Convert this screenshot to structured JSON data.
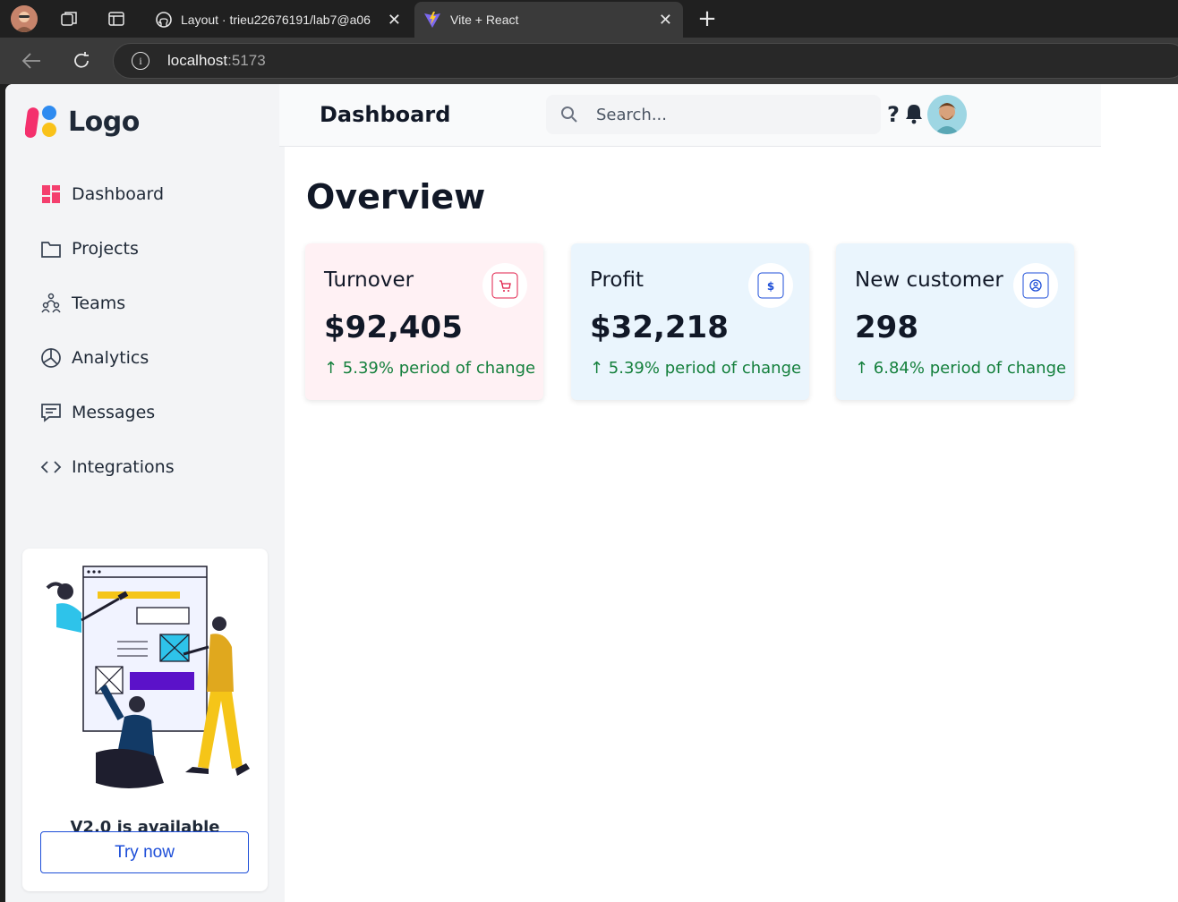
{
  "browser": {
    "tabs": [
      {
        "title": "Layout · trieu22676191/lab7@a06",
        "icon": "github-icon"
      },
      {
        "title": "Vite + React",
        "icon": "vite-icon"
      }
    ],
    "url": {
      "host": "localhost",
      "port": ":5173"
    }
  },
  "app": {
    "logo_text": "Logo",
    "header": {
      "title": "Dashboard",
      "search_placeholder": "Search...",
      "help_label": "?"
    },
    "sidebar": {
      "items": [
        {
          "label": "Dashboard",
          "icon": "dashboard-icon",
          "active": true
        },
        {
          "label": "Projects",
          "icon": "folder-icon"
        },
        {
          "label": "Teams",
          "icon": "teams-icon"
        },
        {
          "label": "Analytics",
          "icon": "pie-chart-icon"
        },
        {
          "label": "Messages",
          "icon": "message-icon"
        },
        {
          "label": "Integrations",
          "icon": "code-icon"
        }
      ],
      "promo": {
        "title": "V2.0 is available",
        "button": "Try now"
      }
    },
    "main": {
      "title": "Overview",
      "cards": [
        {
          "title": "Turnover",
          "value": "$92,405",
          "change": "↑ 5.39% period of change",
          "icon": "cart-icon",
          "bg": "#fff1f4",
          "accent": "#e11d48"
        },
        {
          "title": "Profit",
          "value": "$32,218",
          "change": "↑ 5.39% period of change",
          "icon": "dollar-icon",
          "bg": "#eaf5fd",
          "accent": "#1d4ed8"
        },
        {
          "title": "New customer",
          "value": "298",
          "change": "↑ 6.84% period of change",
          "icon": "user-icon",
          "bg": "#eaf5fd",
          "accent": "#1d4ed8"
        }
      ]
    }
  },
  "colors": {
    "change_positive": "#15803d",
    "primary": "#1d4ed8",
    "sidebar_bg": "#f3f4f6"
  }
}
